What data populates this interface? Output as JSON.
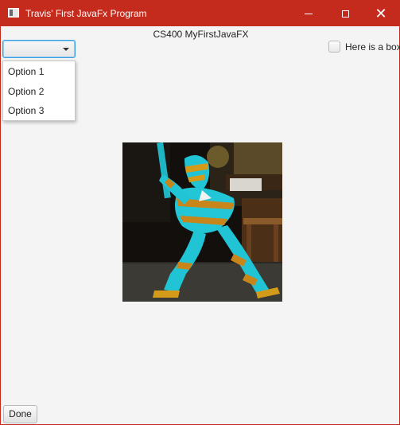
{
  "window": {
    "title": "Travis' First JavaFx Program",
    "controls": {
      "minimize": "minimize-icon",
      "maximize": "maximize-icon",
      "close": "close-icon"
    },
    "accent_color": "#c42b1c"
  },
  "header": {
    "label": "CS400 MyFirstJavaFX"
  },
  "combo": {
    "selected_value": "",
    "expanded": true,
    "options": [
      "Option 1",
      "Option 2",
      "Option 3"
    ]
  },
  "checkbox": {
    "label": "Here is a box",
    "checked": false
  },
  "image": {
    "description_icon": "photo-image"
  },
  "footer": {
    "done_label": "Done"
  }
}
